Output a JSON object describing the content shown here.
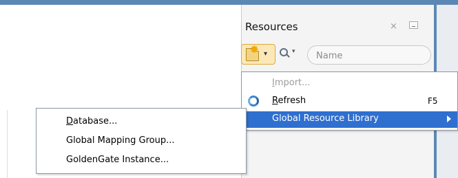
{
  "panel": {
    "title": "Resources",
    "close_glyph": "×",
    "minimize_icon": "minimize-icon"
  },
  "toolbar": {
    "new_icon": "new-folder-star-icon",
    "new_dropdown_glyph": "▾",
    "search_icon": "search-icon",
    "search_dropdown_glyph": "▾",
    "search_placeholder": "Name",
    "search_value": ""
  },
  "context_menu": {
    "items": [
      {
        "label": "Import...",
        "mnemonic": "I",
        "rest": "mport...",
        "enabled": false,
        "icon": "import-icon"
      },
      {
        "label": "Refresh",
        "mnemonic": "R",
        "rest": "efresh",
        "accelerator": "F5",
        "enabled": true,
        "icon": "refresh-icon"
      },
      {
        "label": "Global Resource Library",
        "enabled": true,
        "selected": true,
        "has_submenu": true
      }
    ]
  },
  "submenu": {
    "items": [
      {
        "label": "Database...",
        "mnemonic": "D",
        "rest": "atabase..."
      },
      {
        "label": "Global Mapping Group...",
        "mnemonic": "",
        "rest": "Global Mapping Group..."
      },
      {
        "label": "GoldenGate Instance...",
        "mnemonic": "",
        "rest": "GoldenGate Instance..."
      }
    ]
  },
  "colors": {
    "accent": "#5b87b5",
    "selection": "#2f6fcf",
    "disabled_text": "#9b9b9b"
  }
}
